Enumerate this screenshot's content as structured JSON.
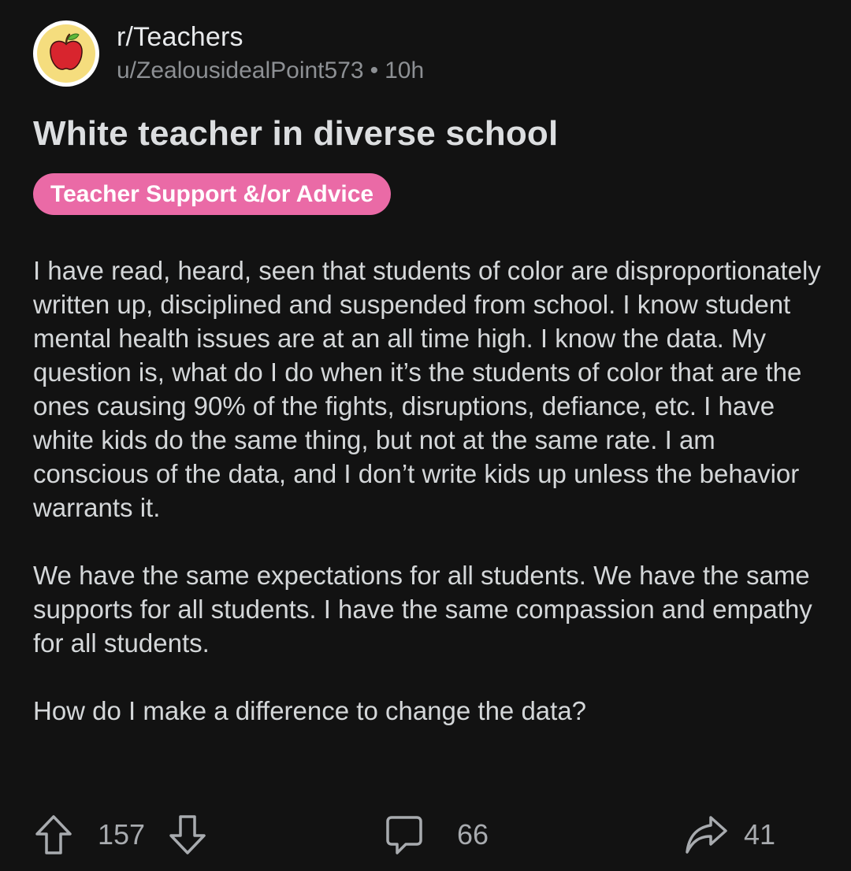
{
  "post": {
    "subreddit": "r/Teachers",
    "author": "u/ZealousidealPoint573",
    "separator": "•",
    "age": "10h",
    "title": "White teacher in diverse school",
    "flair": "Teacher Support &/or Advice",
    "body": [
      "I have read, heard, seen that students of color are disproportionately written up, disciplined and suspended from school. I know student mental health issues are at an all time high. I know the data. My question is, what do I do when it’s the students of color that are the ones causing 90% of the fights, disruptions, defiance, etc. I have white kids do the same thing, but not at the same rate. I am conscious of the data, and I don’t write kids up unless the behavior warrants it.",
      "We have the same expectations for all students. We have the same supports for all students. I have the same compassion and empathy for all students.",
      "How do I make a difference to change the data?"
    ]
  },
  "actions": {
    "upvotes": "157",
    "comments": "66",
    "shares": "41"
  },
  "icons": {
    "avatar": "apple-icon",
    "upvote": "arrow-up-icon",
    "downvote": "arrow-down-icon",
    "comment": "comment-bubble-icon",
    "share": "share-arrow-icon"
  },
  "colors": {
    "background": "#121212",
    "flair": "#ea6aa6",
    "avatar_ring": "#f5dd7e",
    "apple": "#d8252e"
  }
}
